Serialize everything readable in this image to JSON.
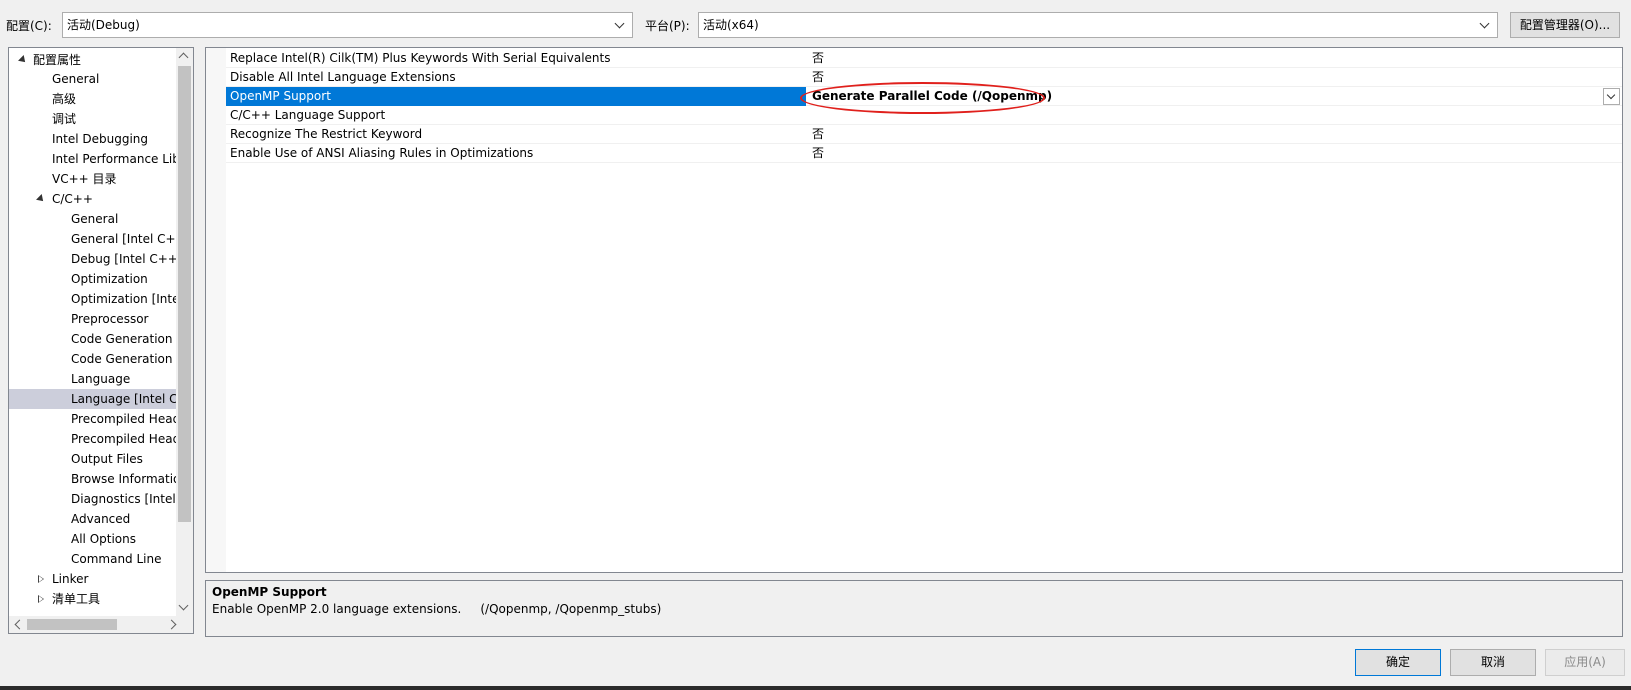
{
  "topbar": {
    "config_label": "配置(C):",
    "config_value": "活动(Debug)",
    "platform_label": "平台(P):",
    "platform_value": "活动(x64)",
    "config_manager_label": "配置管理器(O)..."
  },
  "tree": {
    "items": [
      {
        "label": "配置属性"
      },
      {
        "label": "General"
      },
      {
        "label": "高级"
      },
      {
        "label": "调试"
      },
      {
        "label": "Intel Debugging"
      },
      {
        "label": "Intel Performance Libraries"
      },
      {
        "label": "VC++ 目录"
      },
      {
        "label": "C/C++"
      },
      {
        "label": "General"
      },
      {
        "label": "General [Intel C++]"
      },
      {
        "label": "Debug [Intel C++]"
      },
      {
        "label": "Optimization"
      },
      {
        "label": "Optimization [Intel C++]"
      },
      {
        "label": "Preprocessor"
      },
      {
        "label": "Code Generation"
      },
      {
        "label": "Code Generation [Intel C++]"
      },
      {
        "label": "Language"
      },
      {
        "label": "Language [Intel C++]"
      },
      {
        "label": "Precompiled Headers"
      },
      {
        "label": "Precompiled Headers [Intel C++]"
      },
      {
        "label": "Output Files"
      },
      {
        "label": "Browse Information"
      },
      {
        "label": "Diagnostics [Intel C++]"
      },
      {
        "label": "Advanced"
      },
      {
        "label": "All Options"
      },
      {
        "label": "Command Line"
      },
      {
        "label": "Linker"
      },
      {
        "label": "清单工具"
      }
    ]
  },
  "grid": {
    "rows": [
      {
        "name": "Replace Intel(R) Cilk(TM) Plus Keywords With Serial Equivalents",
        "value": "否"
      },
      {
        "name": "Disable All Intel Language Extensions",
        "value": "否"
      },
      {
        "name": "OpenMP Support",
        "value": "Generate Parallel Code (/Qopenmp)"
      },
      {
        "name": "C/C++ Language Support",
        "value": ""
      },
      {
        "name": "Recognize The Restrict Keyword",
        "value": "否"
      },
      {
        "name": "Enable Use of ANSI Aliasing Rules in Optimizations",
        "value": "否"
      }
    ]
  },
  "description": {
    "title": "OpenMP Support",
    "text": "Enable OpenMP 2.0 language extensions.     (/Qopenmp, /Qopenmp_stubs)"
  },
  "buttons": {
    "ok": "确定",
    "cancel": "取消",
    "apply": "应用(A)"
  },
  "colors": {
    "selection_blue": "#0078d7",
    "tree_selection": "#cccedb",
    "annotation_red": "#e0201c"
  }
}
